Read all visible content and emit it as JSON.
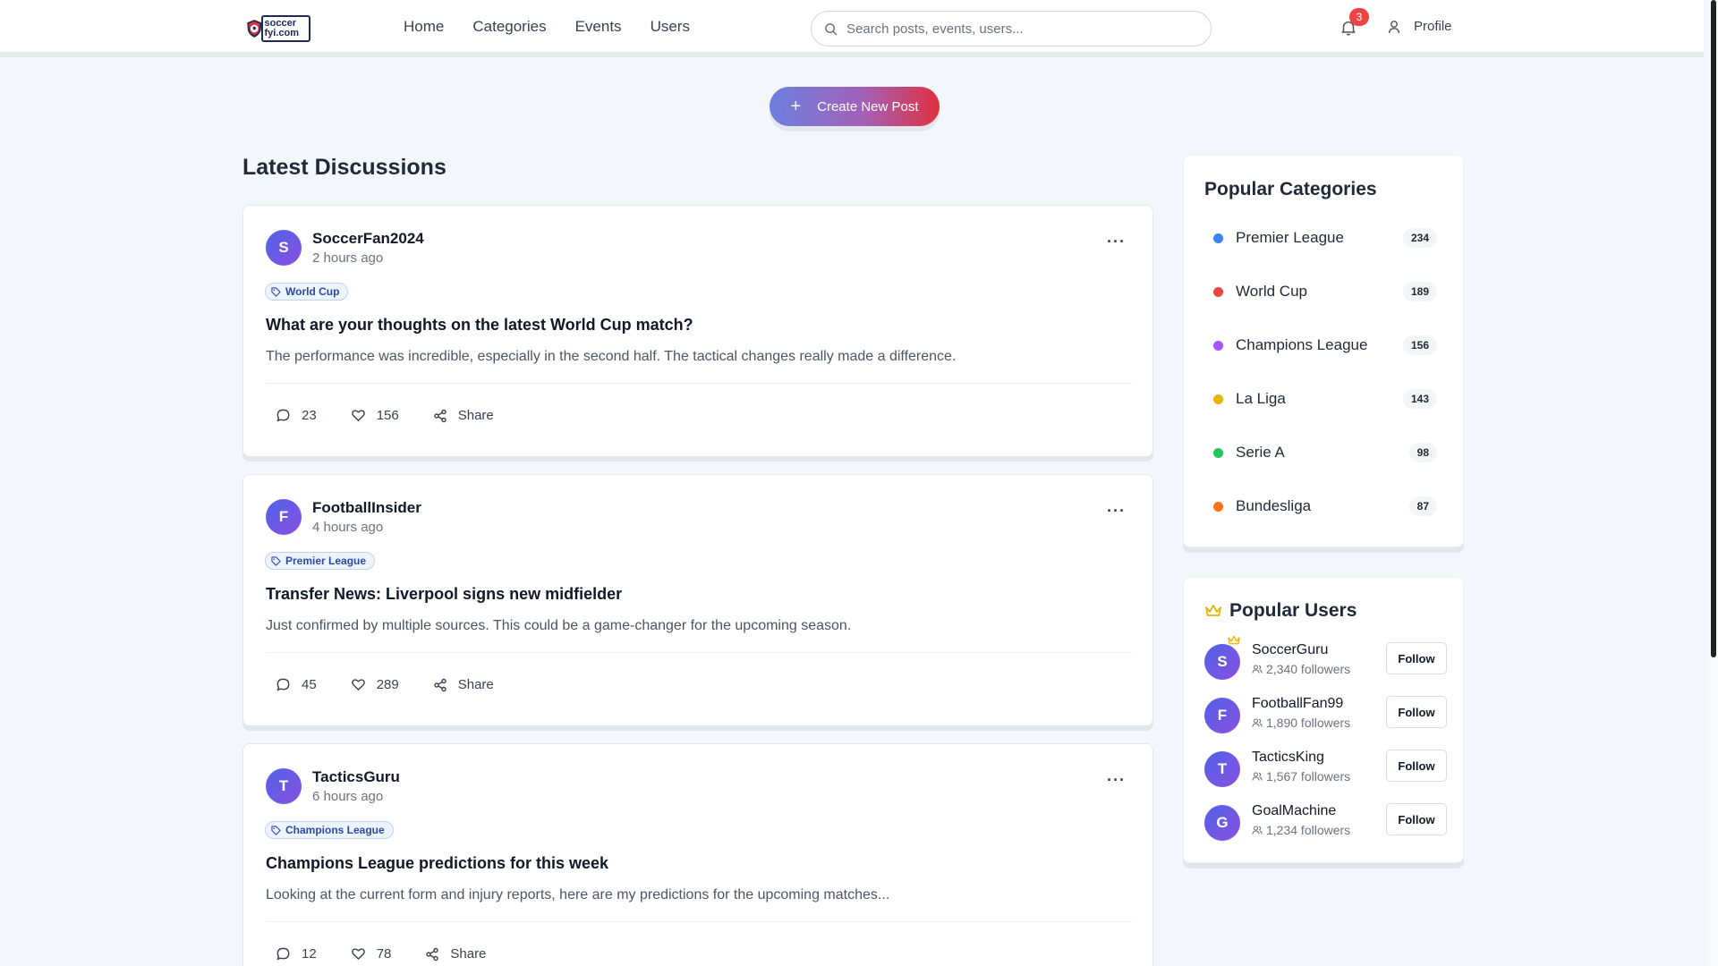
{
  "brand": {
    "logo_text": "soccer fyi.com"
  },
  "nav": {
    "items": [
      "Home",
      "Categories",
      "Events",
      "Users"
    ]
  },
  "search": {
    "placeholder": "Search posts, events, users..."
  },
  "notifications": {
    "count": "3"
  },
  "profile": {
    "label": "Profile"
  },
  "create_button": {
    "label": "Create New Post"
  },
  "feed": {
    "title": "Latest Discussions",
    "posts": [
      {
        "initial": "S",
        "author": "SoccerFan2024",
        "time": "2 hours ago",
        "tag": "World Cup",
        "title": "What are your thoughts on the latest World Cup match?",
        "body": "The performance was incredible, especially in the second half. The tactical changes really made a difference.",
        "comments": "23",
        "likes": "156",
        "share": "Share"
      },
      {
        "initial": "F",
        "author": "FootballInsider",
        "time": "4 hours ago",
        "tag": "Premier League",
        "title": "Transfer News: Liverpool signs new midfielder",
        "body": "Just confirmed by multiple sources. This could be a game-changer for the upcoming season.",
        "comments": "45",
        "likes": "289",
        "share": "Share"
      },
      {
        "initial": "T",
        "author": "TacticsGuru",
        "time": "6 hours ago",
        "tag": "Champions League",
        "title": "Champions League predictions for this week",
        "body": "Looking at the current form and injury reports, here are my predictions for the upcoming matches...",
        "comments": "12",
        "likes": "78",
        "share": "Share"
      }
    ]
  },
  "categories": {
    "title": "Popular Categories",
    "items": [
      {
        "name": "Premier League",
        "count": "234",
        "color": "#3b82f6"
      },
      {
        "name": "World Cup",
        "count": "189",
        "color": "#ef4444"
      },
      {
        "name": "Champions League",
        "count": "156",
        "color": "#a855f7"
      },
      {
        "name": "La Liga",
        "count": "143",
        "color": "#eab308"
      },
      {
        "name": "Serie A",
        "count": "98",
        "color": "#22c55e"
      },
      {
        "name": "Bundesliga",
        "count": "87",
        "color": "#f97316"
      }
    ]
  },
  "popular_users": {
    "title": "Popular Users",
    "follow_label": "Follow",
    "items": [
      {
        "initial": "S",
        "name": "SoccerGuru",
        "followers": "2,340 followers"
      },
      {
        "initial": "F",
        "name": "FootballFan99",
        "followers": "1,890 followers"
      },
      {
        "initial": "T",
        "name": "TacticsKing",
        "followers": "1,567 followers"
      },
      {
        "initial": "G",
        "name": "GoalMachine",
        "followers": "1,234 followers"
      }
    ]
  }
}
